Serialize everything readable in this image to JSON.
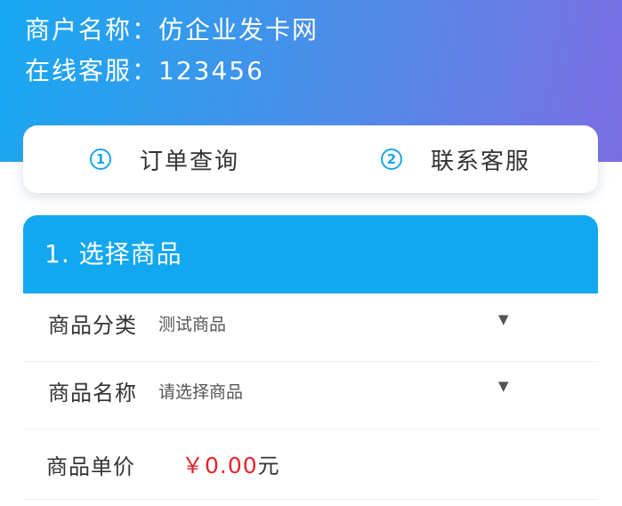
{
  "header": {
    "merchant_label": "商户名称：仿企业发卡网",
    "service_label": "在线客服：123456"
  },
  "tabs": [
    {
      "number": "1",
      "label": "订单查询"
    },
    {
      "number": "2",
      "label": "联系客服"
    }
  ],
  "section": {
    "title": "1. 选择商品"
  },
  "form": {
    "category": {
      "label": "商品分类",
      "value": "测试商品",
      "arrow": "▼"
    },
    "product": {
      "label": "商品名称",
      "value": "请选择商品",
      "arrow": "▼"
    },
    "price": {
      "label": "商品单价",
      "amount": "￥0.00",
      "unit": "元"
    }
  },
  "colors": {
    "header_gradient_start": "#17a9f2",
    "header_gradient_end": "#7b6ee5",
    "accent_blue": "#12a8f0",
    "price_red": "#e3252a"
  }
}
